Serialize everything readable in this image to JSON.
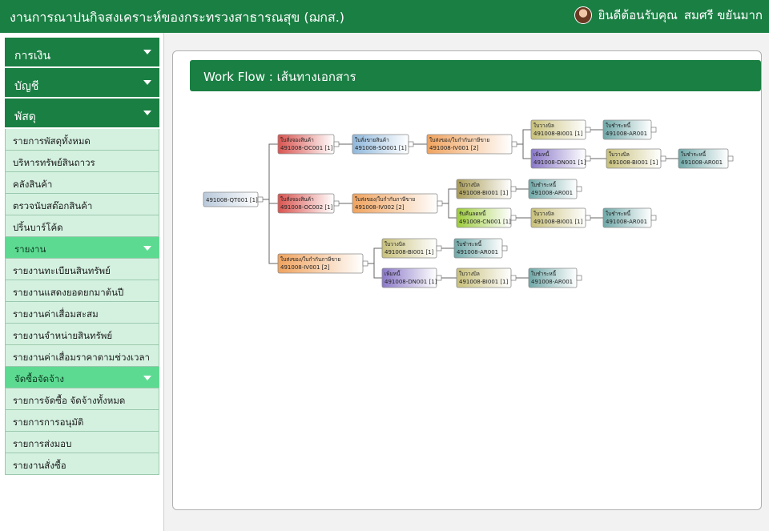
{
  "header": {
    "app_title": "งานการณาปนกิจสงเคราะห์ของกระทรวงสาธารณสุข (ฌกส.)",
    "welcome": "ยินดีต้อนรับคุณ",
    "user_name": "สมศรี ขยันมาก"
  },
  "sidebar": {
    "main_menus": [
      "การเงิน",
      "บัญชี",
      "พัสดุ"
    ],
    "supply_items": [
      "รายการพัสดุทั้งหมด",
      "บริหารทรัพย์สินถาวร",
      "คลังสินค้า",
      "ตรวจนับสต๊อกสินค้า",
      "ปริ้นบาร์โค้ด"
    ],
    "report_section": "รายงาน",
    "report_items": [
      "รายงานทะเบียนสินทรัพย์",
      "รายงานแสดงยอดยกมาต้นปี",
      "รายงานค่าเสื่อมสะสม",
      "รายงานจำหน่ายสินทรัพย์",
      "รายงานค่าเสื่อมราคาตามช่วงเวลา"
    ],
    "procure_section": "จัดซื้อจัดจ้าง",
    "procure_items": [
      "รายการจัดซื้อ จัดจ้างทั้งหมด",
      "รายการการอนุมัติ",
      "รายการส่งมอบ",
      "รายงานสั่งซื้อ"
    ]
  },
  "panel": {
    "title": "Work Flow : เส้นทางเอกสาร"
  },
  "colors": {
    "brand_green": "#1a7f43",
    "sub_bg": "#d4f1e0",
    "section_bg": "#5dda92"
  },
  "workflow": {
    "root": {
      "title": "",
      "code": "491008-QT001 [1]",
      "color": "#b9c9db"
    },
    "nodes": [
      {
        "id": "oc1",
        "title": "ใบสั่งจองสินค้า",
        "code": "491008-OC001 [1]",
        "color": "#d9534f"
      },
      {
        "id": "so1",
        "title": "ใบสั่งขายสินค้า",
        "code": "491008-SO001 [1]",
        "color": "#8fb8dc"
      },
      {
        "id": "iv1",
        "title": "ใบส่งของ/ใบกำกับภาษีขาย",
        "code": "491008-IV001 [2]",
        "color": "#f0a35e"
      },
      {
        "id": "bi1",
        "title": "ใบวางบิล",
        "code": "491008-BI001 [1]",
        "color": "#c8c07a"
      },
      {
        "id": "ar1",
        "title": "ใบชำระหนี้",
        "code": "491008-AR001",
        "color": "#6fa8a8"
      },
      {
        "id": "dn1",
        "title": "เพิ่มหนี้",
        "code": "491008-DN001 [1]",
        "color": "#8a78c8"
      },
      {
        "id": "bi2",
        "title": "ใบวางบิล",
        "code": "491008-BI001 [1]",
        "color": "#c8c07a"
      },
      {
        "id": "ar2",
        "title": "ใบชำระหนี้",
        "code": "491008-AR001",
        "color": "#6fa8a8"
      },
      {
        "id": "oc2",
        "title": "ใบสั่งจองสินค้า",
        "code": "491008-OC002 [1]",
        "color": "#d9534f"
      },
      {
        "id": "iv2",
        "title": "ใบส่งของ/ใบกำกับภาษีขาย",
        "code": "491008-IV002 [2]",
        "color": "#f0a35e"
      },
      {
        "id": "bi3",
        "title": "ใบวางบิล",
        "code": "491008-BI001 [1]",
        "color": "#a89b55"
      },
      {
        "id": "ar3",
        "title": "ใบชำระหนี้",
        "code": "491008-AR001",
        "color": "#6fa8a8"
      },
      {
        "id": "cn1",
        "title": "รับคืนลดหนี้",
        "code": "491008-CN001 [1]",
        "color": "#9ccc3a"
      },
      {
        "id": "bi4",
        "title": "ใบวางบิล",
        "code": "491008-BI001 [1]",
        "color": "#c8c07a"
      },
      {
        "id": "ar4",
        "title": "ใบชำระหนี้",
        "code": "491008-AR001",
        "color": "#6fa8a8"
      },
      {
        "id": "iv3",
        "title": "ใบส่งของ/ใบกำกับภาษีขาย",
        "code": "491008-IV001 [2]",
        "color": "#f0a35e"
      },
      {
        "id": "bi5",
        "title": "ใบวางบิล",
        "code": "491008-BI001 [1]",
        "color": "#c8c07a"
      },
      {
        "id": "ar5",
        "title": "ใบชำระหนี้",
        "code": "491008-AR001",
        "color": "#6fa8a8"
      },
      {
        "id": "dn2",
        "title": "เพิ่มหนี้",
        "code": "491008-DN001 [1]",
        "color": "#8a78c8"
      },
      {
        "id": "bi6",
        "title": "ใบวางบิล",
        "code": "491008-BI001 [1]",
        "color": "#c8c07a"
      },
      {
        "id": "ar6",
        "title": "ใบชำระหนี้",
        "code": "491008-AR001",
        "color": "#6fa8a8"
      }
    ],
    "edges": [
      [
        "root",
        "oc1"
      ],
      [
        "oc1",
        "so1"
      ],
      [
        "so1",
        "iv1"
      ],
      [
        "iv1",
        "bi1"
      ],
      [
        "bi1",
        "ar1"
      ],
      [
        "iv1",
        "dn1"
      ],
      [
        "dn1",
        "bi2"
      ],
      [
        "bi2",
        "ar2"
      ],
      [
        "root",
        "oc2"
      ],
      [
        "oc2",
        "iv2"
      ],
      [
        "iv2",
        "bi3"
      ],
      [
        "bi3",
        "ar3"
      ],
      [
        "iv2",
        "cn1"
      ],
      [
        "cn1",
        "bi4"
      ],
      [
        "bi4",
        "ar4"
      ],
      [
        "root",
        "iv3"
      ],
      [
        "iv3",
        "bi5"
      ],
      [
        "bi5",
        "ar5"
      ],
      [
        "iv3",
        "dn2"
      ],
      [
        "dn2",
        "bi6"
      ],
      [
        "bi6",
        "ar6"
      ]
    ]
  }
}
